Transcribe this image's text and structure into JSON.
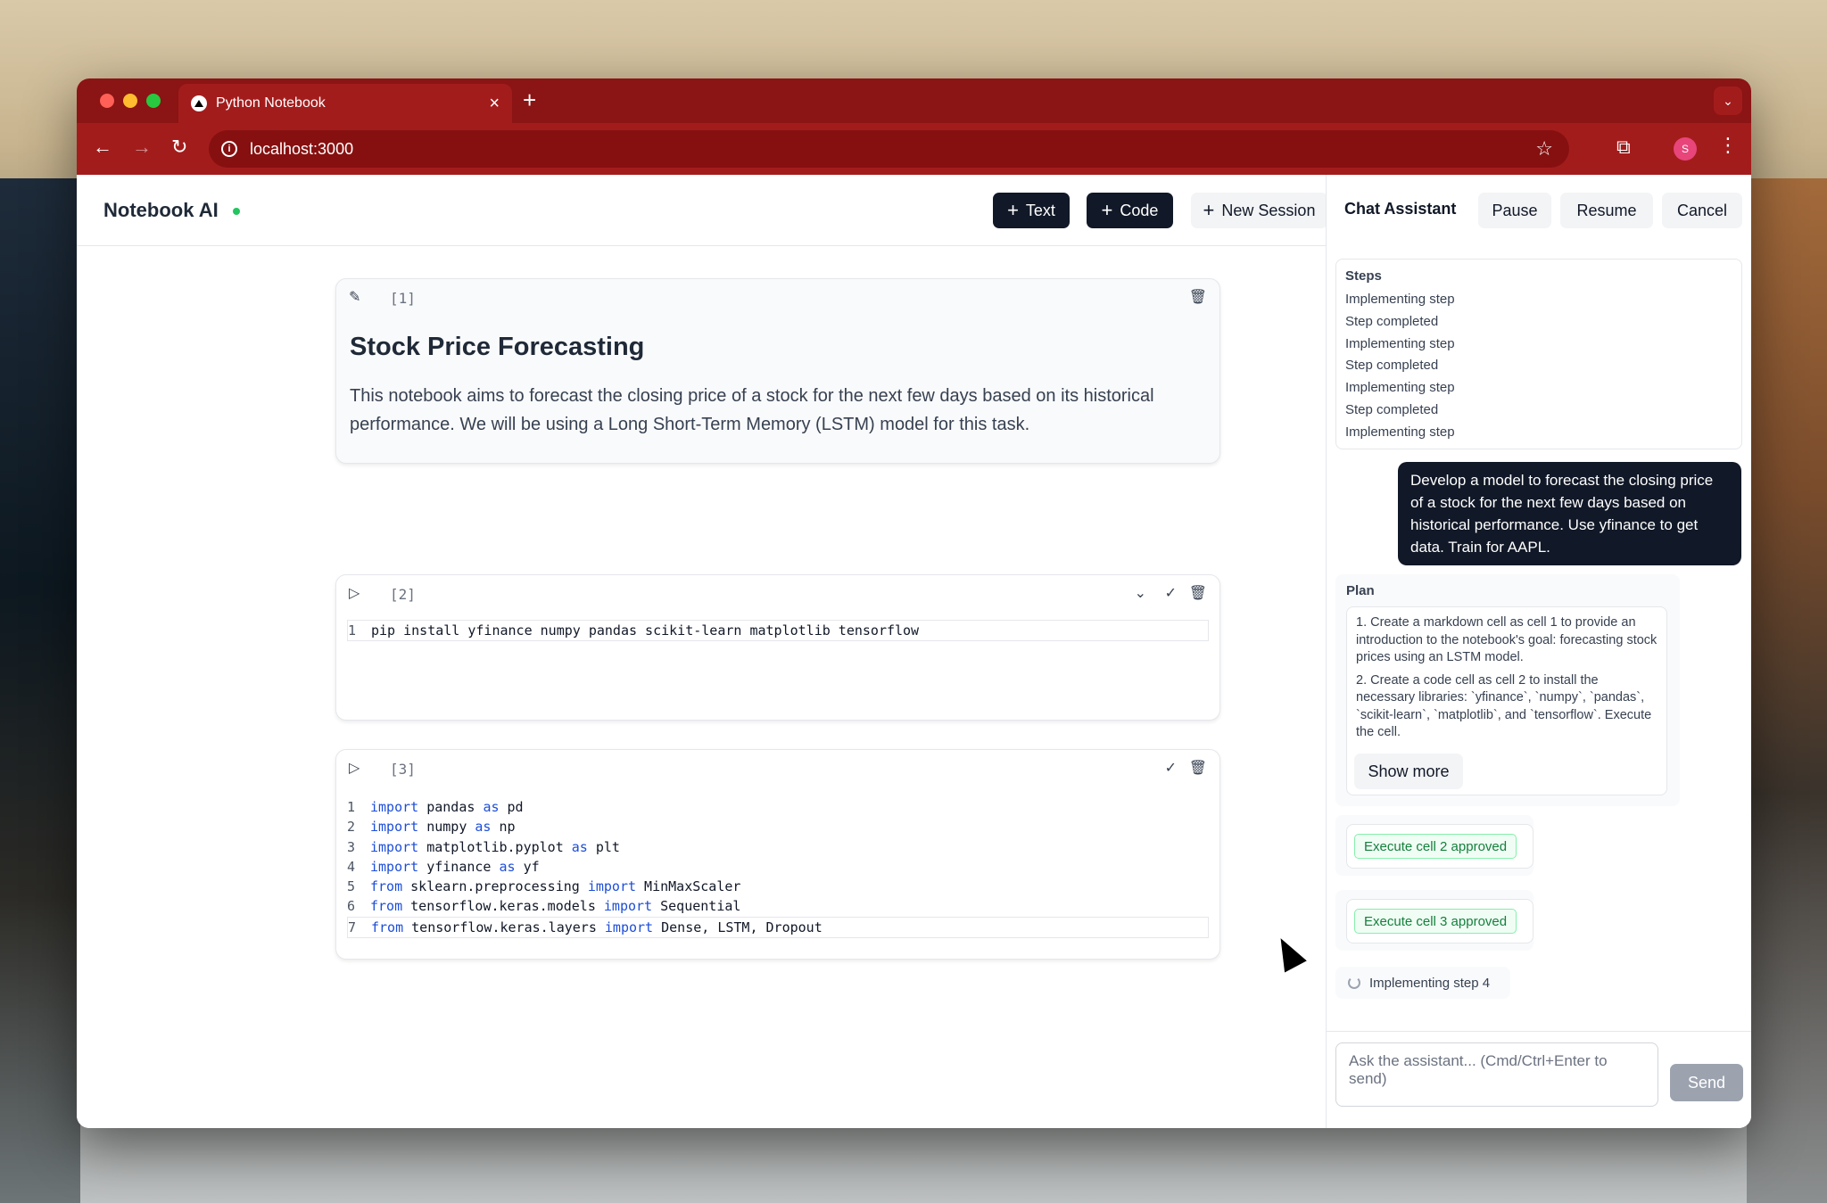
{
  "browser": {
    "tab_title": "Python Notebook",
    "new_tab": "+",
    "url": "localhost:3000",
    "profile_initial": "S"
  },
  "header": {
    "brand": "Notebook AI",
    "text_button": "Text",
    "code_button": "Code",
    "new_session_button": "New Session"
  },
  "cells": [
    {
      "number": "[1]",
      "title": "Stock Price Forecasting",
      "body": "This notebook aims to forecast the closing price of a stock for the next few days based on its historical performance. We will be using a Long Short-Term Memory (LSTM) model for this task."
    },
    {
      "number": "[2]",
      "lines": [
        {
          "n": "1",
          "code": "pip install yfinance numpy pandas scikit-learn matplotlib tensorflow"
        }
      ]
    },
    {
      "number": "[3]",
      "lines": [
        {
          "n": "1",
          "parts": [
            [
              "kw",
              "import"
            ],
            [
              "t",
              " pandas "
            ],
            [
              "kw",
              "as"
            ],
            [
              "t",
              " pd"
            ]
          ]
        },
        {
          "n": "2",
          "parts": [
            [
              "kw",
              "import"
            ],
            [
              "t",
              " numpy "
            ],
            [
              "kw",
              "as"
            ],
            [
              "t",
              " np"
            ]
          ]
        },
        {
          "n": "3",
          "parts": [
            [
              "kw",
              "import"
            ],
            [
              "t",
              " matplotlib.pyplot "
            ],
            [
              "kw",
              "as"
            ],
            [
              "t",
              " plt"
            ]
          ]
        },
        {
          "n": "4",
          "parts": [
            [
              "kw",
              "import"
            ],
            [
              "t",
              " yfinance "
            ],
            [
              "kw",
              "as"
            ],
            [
              "t",
              " yf"
            ]
          ]
        },
        {
          "n": "5",
          "parts": [
            [
              "kw",
              "from"
            ],
            [
              "t",
              " sklearn.preprocessing "
            ],
            [
              "kw",
              "import"
            ],
            [
              "t",
              " MinMaxScaler"
            ]
          ]
        },
        {
          "n": "6",
          "parts": [
            [
              "kw",
              "from"
            ],
            [
              "t",
              " tensorflow.keras.models "
            ],
            [
              "kw",
              "import"
            ],
            [
              "t",
              " Sequential"
            ]
          ]
        },
        {
          "n": "7",
          "parts": [
            [
              "kw",
              "from"
            ],
            [
              "t",
              " tensorflow.keras.layers "
            ],
            [
              "kw",
              "import"
            ],
            [
              "t",
              " Dense, LSTM, Dropout"
            ]
          ]
        }
      ]
    }
  ],
  "chat": {
    "title": "Chat Assistant",
    "pause": "Pause",
    "resume": "Resume",
    "cancel": "Cancel",
    "steps_title": "Steps",
    "steps": [
      "Implementing step",
      "Step completed",
      "Implementing step",
      "Step completed",
      "Implementing step",
      "Step completed",
      "Implementing step"
    ],
    "user_message": "Develop a model to forecast the closing price of a stock for the next few days based on historical performance. Use yfinance to get data. Train for AAPL.",
    "plan_title": "Plan",
    "plan_items": [
      "1. Create a markdown cell as cell 1 to provide an introduction to the notebook's goal: forecasting stock prices using an LSTM model.",
      "2. Create a code cell as cell 2 to install the necessary libraries: `yfinance`, `numpy`, `pandas`, `scikit-learn`, `matplotlib`, and `tensorflow`. Execute the cell."
    ],
    "show_more": "Show more",
    "exec_2": "Execute cell 2 approved",
    "exec_3": "Execute cell 3 approved",
    "progress": "Implementing step 4",
    "input_placeholder": "Ask the assistant... (Cmd/Ctrl+Enter to send)",
    "send": "Send"
  }
}
